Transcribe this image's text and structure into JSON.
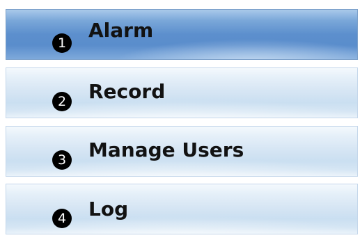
{
  "menu": {
    "items": [
      {
        "number": "1",
        "label": "Alarm",
        "selected": true
      },
      {
        "number": "2",
        "label": "Record",
        "selected": false
      },
      {
        "number": "3",
        "label": "Manage Users",
        "selected": false
      },
      {
        "number": "4",
        "label": "Log",
        "selected": false
      }
    ]
  },
  "colors": {
    "selected_background": "#5c8fcd",
    "normal_background": "#d7e6f4",
    "badge": "#000000",
    "label_text": "#121212"
  }
}
